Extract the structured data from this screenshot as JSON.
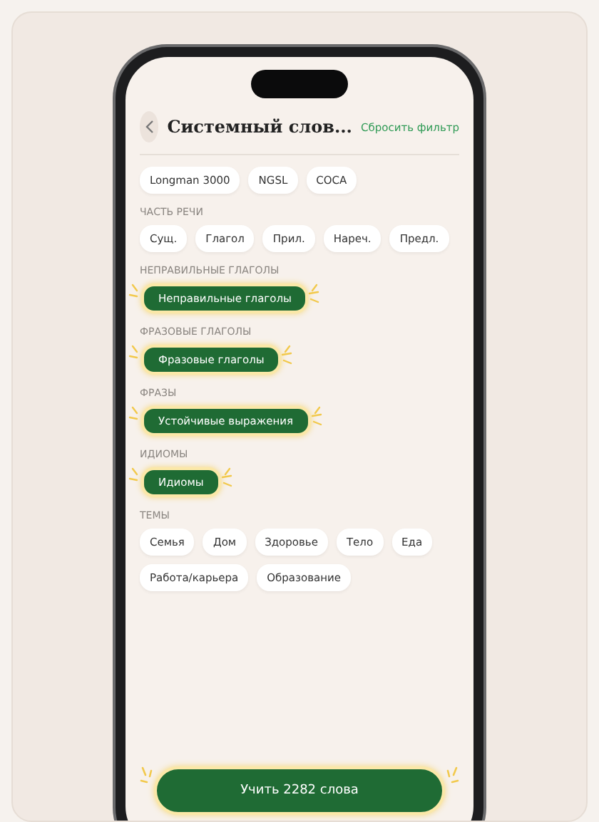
{
  "header": {
    "title": "Системный слов...",
    "reset_link": "Сбросить фильтр"
  },
  "sections": [
    {
      "chips": [
        {
          "label": "Longman 3000",
          "selected": false
        },
        {
          "label": "NGSL",
          "selected": false
        },
        {
          "label": "COCA",
          "selected": false
        }
      ]
    },
    {
      "title": "ЧАСТЬ РЕЧИ",
      "chips": [
        {
          "label": "Сущ.",
          "selected": false
        },
        {
          "label": "Глагол",
          "selected": false
        },
        {
          "label": "Прил.",
          "selected": false
        },
        {
          "label": "Нареч.",
          "selected": false
        },
        {
          "label": "Предл.",
          "selected": false
        }
      ]
    },
    {
      "title": "НЕПРАВИЛЬНЫЕ ГЛАГОЛЫ",
      "chips": [
        {
          "label": "Неправильные глаголы",
          "selected": true
        }
      ]
    },
    {
      "title": "ФРАЗОВЫЕ ГЛАГОЛЫ",
      "chips": [
        {
          "label": "Фразовые глаголы",
          "selected": true
        }
      ]
    },
    {
      "title": "ФРАЗЫ",
      "chips": [
        {
          "label": "Устойчивые выражения",
          "selected": true
        }
      ]
    },
    {
      "title": "ИДИОМЫ",
      "chips": [
        {
          "label": "Идиомы",
          "selected": true
        }
      ]
    },
    {
      "title": "ТЕМЫ",
      "chips": [
        {
          "label": "Семья",
          "selected": false
        },
        {
          "label": "Дом",
          "selected": false
        },
        {
          "label": "Здоровье",
          "selected": false
        },
        {
          "label": "Тело",
          "selected": false
        },
        {
          "label": "Еда",
          "selected": false
        },
        {
          "label": "Работа/карьера",
          "selected": false
        },
        {
          "label": "Образование",
          "selected": false
        }
      ]
    }
  ],
  "action_button": "Учить 2282 слова"
}
